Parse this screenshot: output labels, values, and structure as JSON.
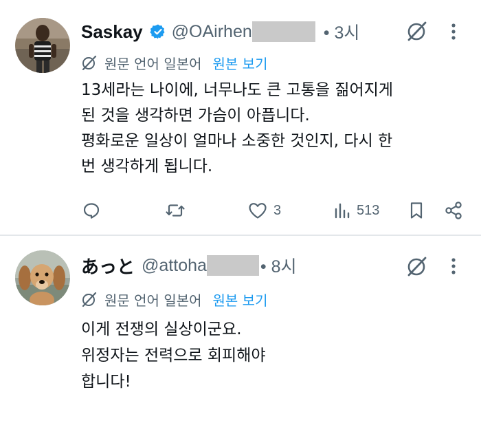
{
  "colors": {
    "text": "#0f1419",
    "secondary": "#536471",
    "accent": "#1d9bf0",
    "verified": "#1d9bf0",
    "divider": "#e3e7ea",
    "redaction": "#c9c9c9"
  },
  "tweets": [
    {
      "display_name": "Saskay",
      "handle_prefix": "@OAirhen",
      "time": "• 3시",
      "verified": true,
      "translated_label": "원문 언어 일본어",
      "show_original": "원본 보기",
      "text_lines": [
        "13세라는 나이에, 너무나도 큰 고통을 짊어지게",
        "된 것을 생각하면 가슴이 아픕니다.",
        "평화로운 일상이 얼마나 소중한 것인지, 다시 한",
        "번 생각하게 됩니다."
      ],
      "actions": {
        "reply_count": "",
        "retweet_count": "",
        "like_count": "3",
        "view_count": "513"
      },
      "icons": [
        "grok-icon",
        "more-icon",
        "translate-icon",
        "verified-badge-icon",
        "reply-icon",
        "retweet-icon",
        "heart-icon",
        "views-icon",
        "bookmark-icon",
        "share-icon"
      ]
    },
    {
      "display_name": "あっと",
      "handle_prefix": "@attoha",
      "time": "• 8시",
      "verified": false,
      "translated_label": "원문 언어 일본어",
      "show_original": "원본 보기",
      "text_lines": [
        "이게 전쟁의 실상이군요.",
        "위정자는 전력으로 회피해야",
        "합니다!"
      ],
      "icons": [
        "grok-icon",
        "more-icon",
        "translate-icon"
      ]
    }
  ]
}
